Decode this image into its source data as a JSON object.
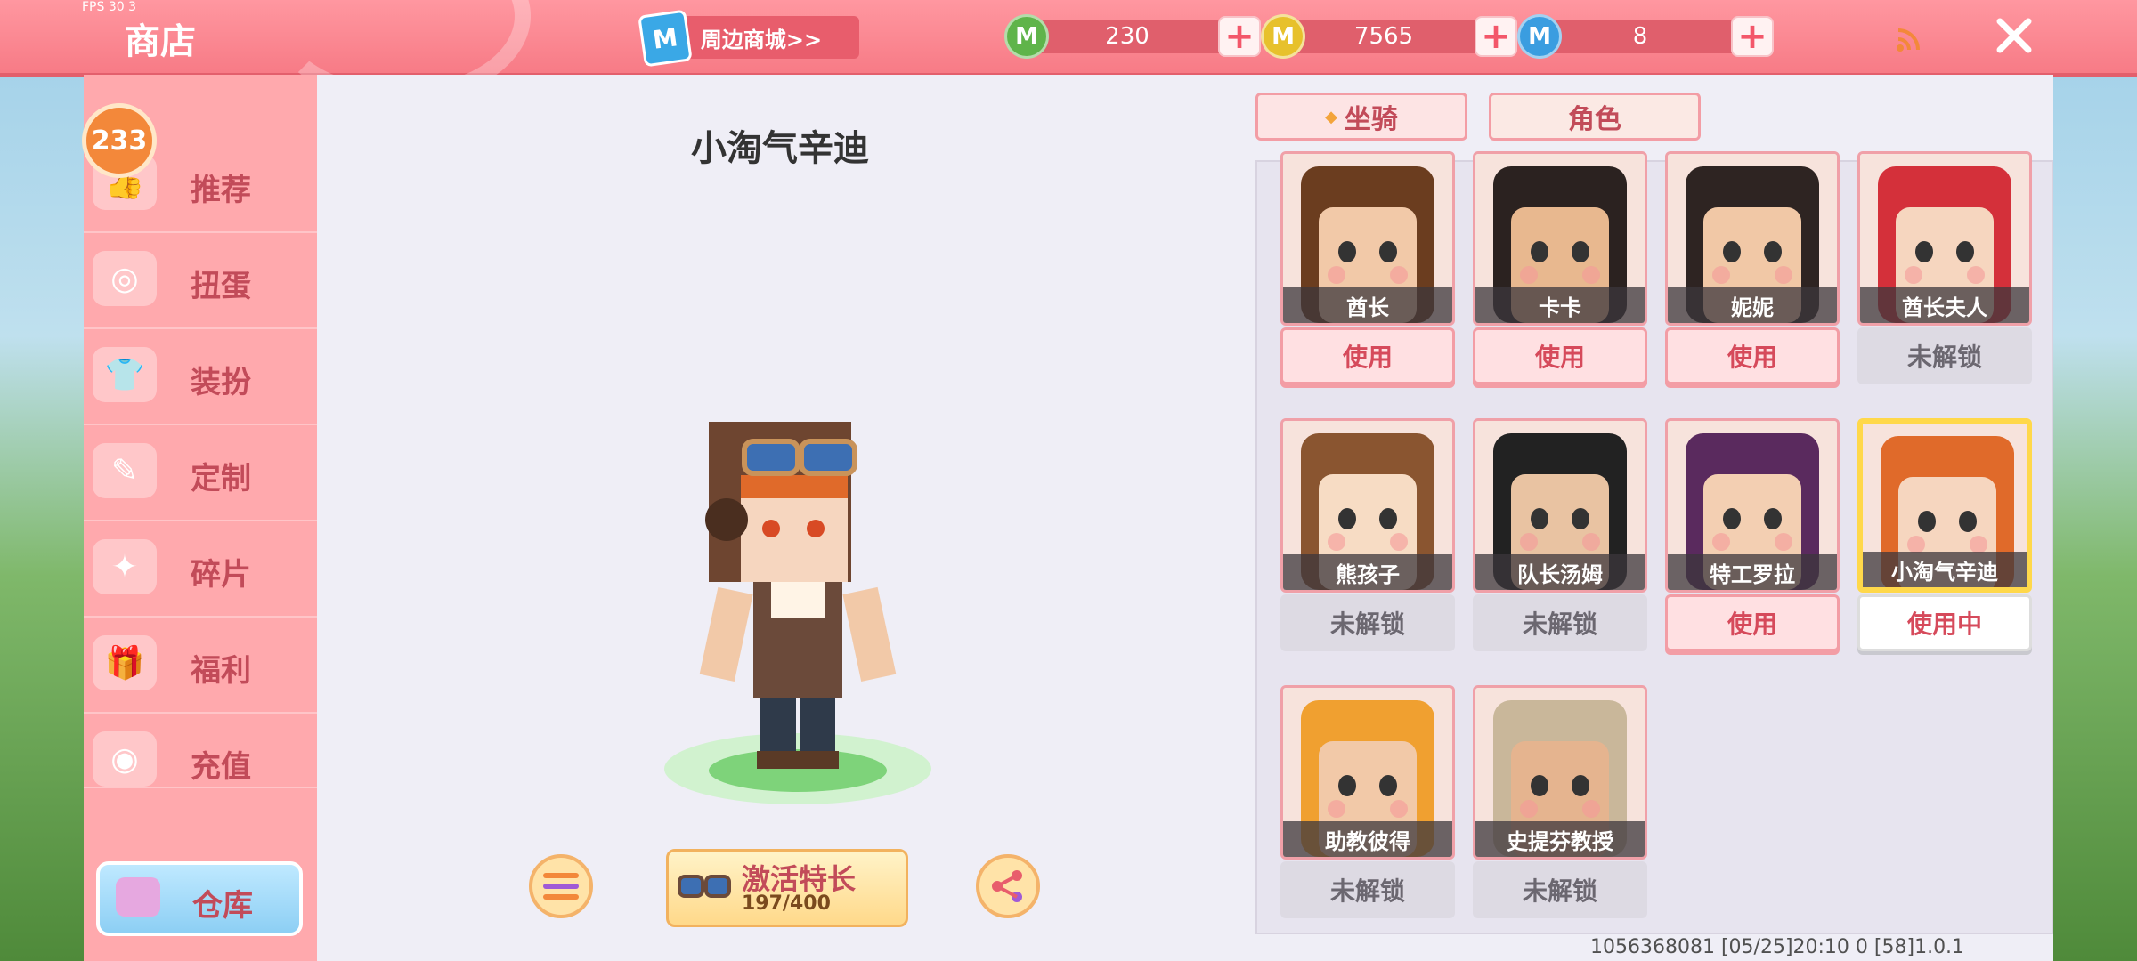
{
  "fps_label": "FPS 30 3",
  "header": {
    "title": "商店",
    "mall_label": "周边商城>>",
    "mall_icon_letter": "M",
    "currencies": [
      {
        "name": "mini-bean",
        "value": "230",
        "color": "#5fb44a",
        "icon": "M"
      },
      {
        "name": "mini-coin",
        "value": "7565",
        "color": "#e7c12c",
        "icon": "M"
      },
      {
        "name": "mini-point",
        "value": "8",
        "color": "#3a9de0",
        "icon": "M"
      }
    ]
  },
  "sidebar": {
    "badge": "233",
    "items": [
      {
        "label": "推荐",
        "icon": "thumbs-up"
      },
      {
        "label": "扭蛋",
        "icon": "capsule"
      },
      {
        "label": "装扮",
        "icon": "shirt"
      },
      {
        "label": "定制",
        "icon": "pencil"
      },
      {
        "label": "碎片",
        "icon": "shards"
      },
      {
        "label": "福利",
        "icon": "gift"
      },
      {
        "label": "充值",
        "icon": "coins"
      }
    ],
    "warehouse_label": "仓库"
  },
  "preview": {
    "character_name": "小淘气辛迪",
    "activate_label": "激活特长",
    "activate_progress_text": "197/400",
    "activate_progress": {
      "current": 197,
      "max": 400
    }
  },
  "tabs": {
    "mount": "坐骑",
    "character": "角色"
  },
  "characters": [
    {
      "name": "酋长",
      "action": "使用",
      "state": "use",
      "hair": "#6b3d1f",
      "skin": "#f2c9a8"
    },
    {
      "name": "卡卡",
      "action": "使用",
      "state": "use",
      "hair": "#2b2220",
      "skin": "#e8b88f"
    },
    {
      "name": "妮妮",
      "action": "使用",
      "state": "use",
      "hair": "#2e2422",
      "skin": "#f1c8a6"
    },
    {
      "name": "酋长夫人",
      "action": "未解锁",
      "state": "locked",
      "hair": "#d4303a",
      "skin": "#f6d6bf"
    },
    {
      "name": "熊孩子",
      "action": "未解锁",
      "state": "locked",
      "hair": "#8a5530",
      "skin": "#f7dcc4"
    },
    {
      "name": "队长汤姆",
      "action": "未解锁",
      "state": "locked",
      "hair": "#222",
      "skin": "#e9c3a2"
    },
    {
      "name": "特工罗拉",
      "action": "使用",
      "state": "use",
      "hair": "#5a2a5e",
      "skin": "#f3cfb2"
    },
    {
      "name": "小淘气辛迪",
      "action": "使用中",
      "state": "inuse",
      "hair": "#e06a2a",
      "skin": "#f6d6bf"
    },
    {
      "name": "助教彼得",
      "action": "未解锁",
      "state": "locked",
      "hair": "#f0a030",
      "skin": "#f2c9a8"
    },
    {
      "name": "史提芬教授",
      "action": "未解锁",
      "state": "locked",
      "hair": "#c9b79a",
      "skin": "#e5b48f"
    }
  ],
  "footer_info": "1056368081   [05/25]20:10 0 [58]1.0.1"
}
